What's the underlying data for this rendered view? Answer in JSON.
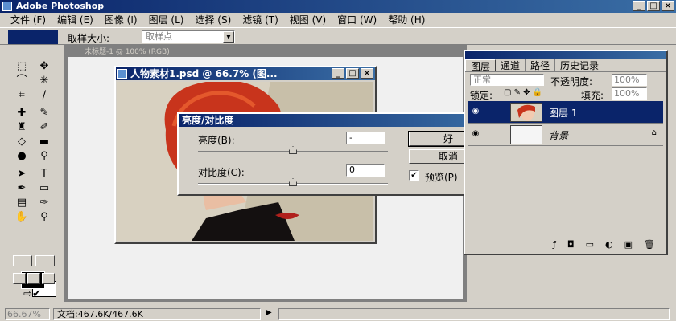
{
  "app": {
    "title": "Adobe Photoshop"
  },
  "menu": [
    "文件 (F)",
    "编辑 (E)",
    "图像 (I)",
    "图层 (L)",
    "选择 (S)",
    "滤镜 (T)",
    "视图 (V)",
    "窗口 (W)",
    "帮助 (H)"
  ],
  "options": {
    "sample_label": "取样大小:",
    "sample_value": "取样点"
  },
  "document": {
    "title": "人物素材1.psd @ 66.7% (图...",
    "bg_title": "未标题-1 @ 100% (RGB)"
  },
  "dialog": {
    "title": "亮度/对比度",
    "brightness_label": "亮度(B):",
    "brightness_value": "-",
    "contrast_label": "对比度(C):",
    "contrast_value": "0",
    "ok_label": "好",
    "cancel_label": "取消",
    "preview_label": "预览(P)",
    "preview_checked": true,
    "brightness_level": 0,
    "contrast_level": 0
  },
  "layers_panel": {
    "tabs": [
      "图层",
      "通道",
      "路径",
      "历史记录"
    ],
    "blend_mode": "正常",
    "opacity_label": "不透明度:",
    "opacity_value": "100%",
    "lock_label": "锁定:",
    "fill_label": "填充:",
    "fill_value": "100%",
    "layers": [
      {
        "name": "图层 1",
        "selected": true
      },
      {
        "name": "背景",
        "selected": false
      }
    ]
  },
  "status": {
    "zoom": "66.67%",
    "docinfo": "文档:467.6K/467.6K"
  },
  "colors": {
    "title_blue": "#0a246a",
    "chrome": "#d4d0c8",
    "hair": "#c8341c"
  }
}
